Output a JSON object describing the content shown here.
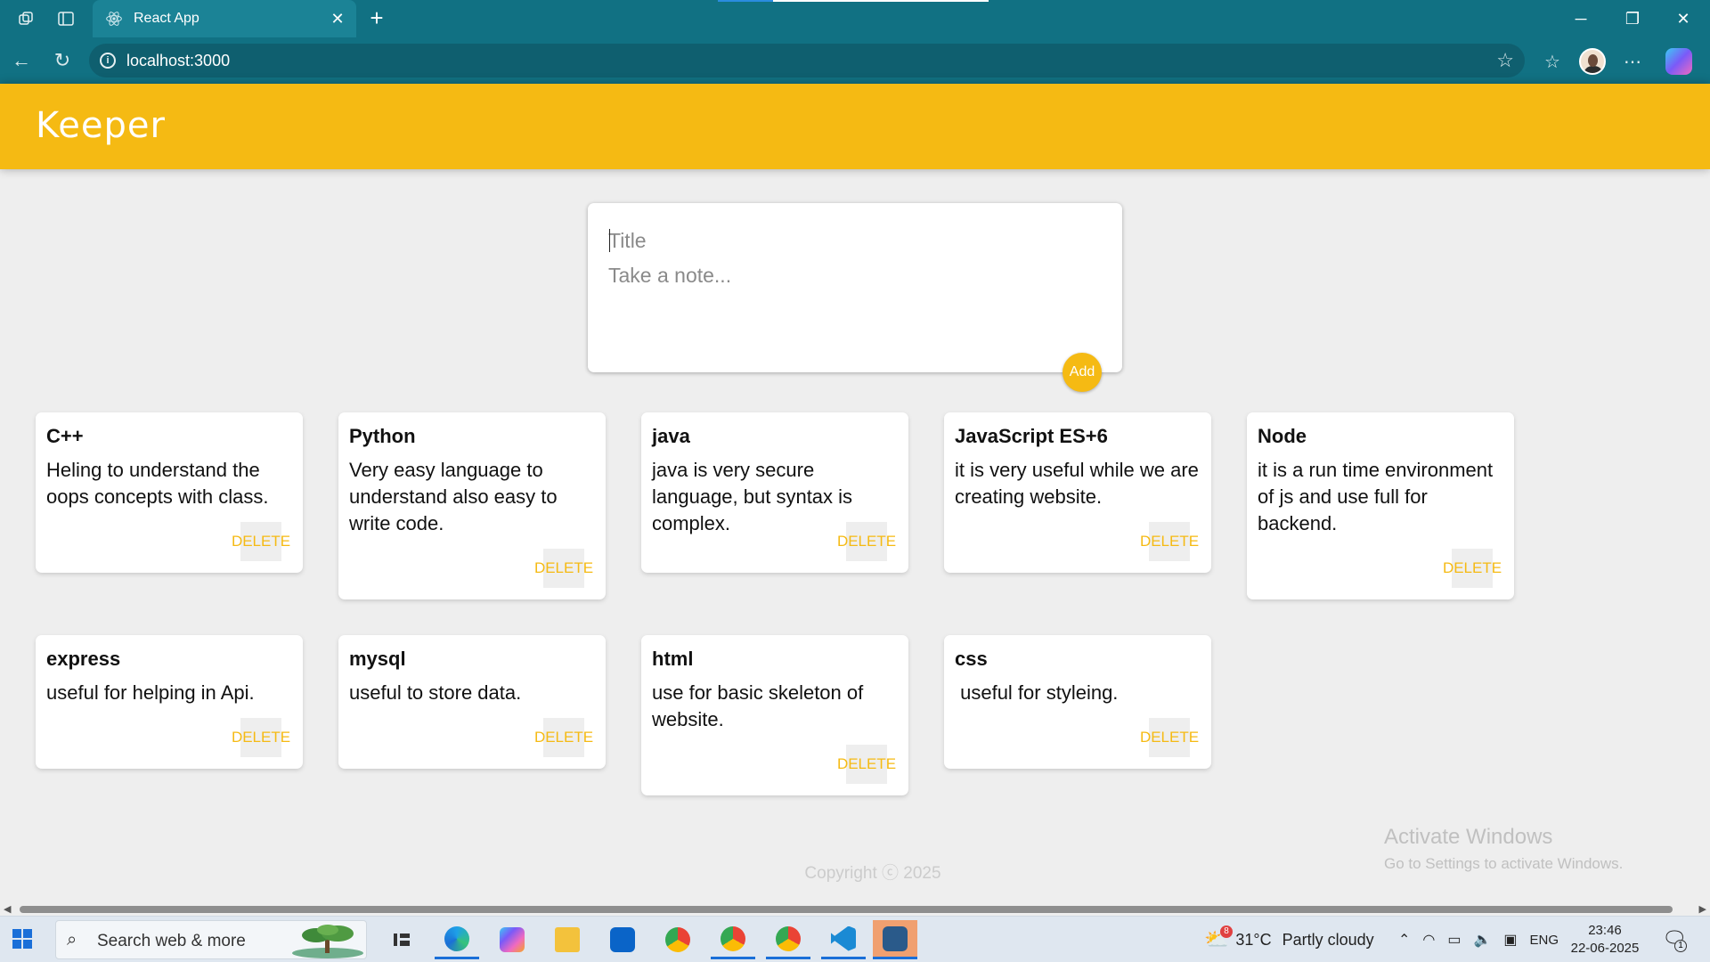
{
  "browser": {
    "tab_title": "React App",
    "url": "localhost:3000"
  },
  "app": {
    "title": "Keeper",
    "create": {
      "title_placeholder": "Title",
      "content_placeholder": "Take a note...",
      "add_label": "Add"
    },
    "delete_label": "DELETE",
    "notes": [
      {
        "title": "C++",
        "content": "Heling to understand the oops concepts with class."
      },
      {
        "title": "Python",
        "content": "Very easy language to understand also easy to write code."
      },
      {
        "title": "java",
        "content": "java is very secure language, but syntax is complex."
      },
      {
        "title": "JavaScript ES+6",
        "content": "it is very useful while we are creating website."
      },
      {
        "title": "Node",
        "content": "it is a run time environment of js and use full for backend."
      },
      {
        "title": "express",
        "content": "useful for helping in Api."
      },
      {
        "title": "mysql",
        "content": "useful to store data."
      },
      {
        "title": "html",
        "content": "use for basic skeleton of website."
      },
      {
        "title": "css",
        "content": " useful for styleing."
      }
    ],
    "footer": "Copyright ⓒ 2025"
  },
  "watermark": {
    "line1": "Activate Windows",
    "line2": "Go to Settings to activate Windows."
  },
  "taskbar": {
    "search_text": "Search web & more",
    "weather_temp": "31°C",
    "weather_desc": "Partly cloudy",
    "weather_badge": "8",
    "lang": "ENG",
    "time": "23:46",
    "date": "22-06-2025",
    "notification_count": "1"
  },
  "colors": {
    "accent": "#f5ba13",
    "browser_frame": "#117183",
    "page_bg": "#eeeeee"
  }
}
